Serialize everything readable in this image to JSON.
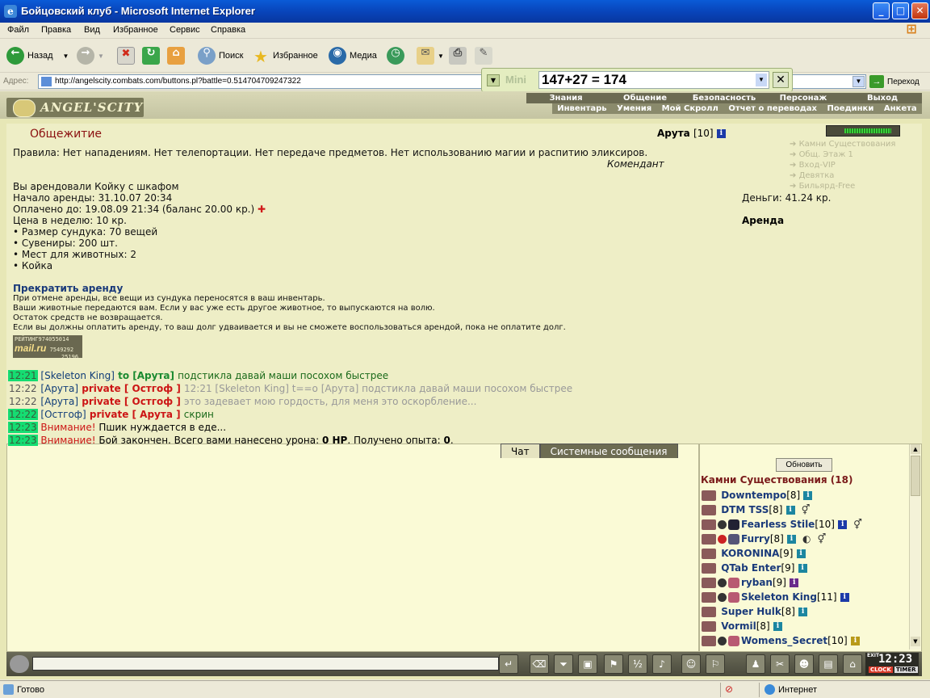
{
  "window": {
    "title": "Бойцовский клуб - Microsoft Internet Explorer",
    "logo_glyph": "e"
  },
  "menu": [
    "Файл",
    "Правка",
    "Вид",
    "Избранное",
    "Сервис",
    "Справка"
  ],
  "toolbar": {
    "back": "Назад",
    "search": "Поиск",
    "favorites": "Избранное",
    "media": "Медиа"
  },
  "address": {
    "label": "Адрес:",
    "url": "http://angelscity.combats.com/buttons.pl?battle=0.514704709247322",
    "go": "Переход"
  },
  "mini": {
    "label": "Mini",
    "value": "147+27 = 174"
  },
  "game": {
    "logo": "ANGEL'SCITY",
    "nav_top": [
      "Знания",
      "Общение",
      "Безопасность",
      "Персонаж",
      "Выход"
    ],
    "nav_sub": [
      "Инвентарь",
      "Умения",
      "Мой Скролл",
      "Отчет о переводах",
      "Поединки",
      "Анкета"
    ]
  },
  "room": {
    "title": "Общежитие",
    "rules": "Правила: Нет нападениям. Нет телепортации. Нет передаче предметов. Нет использованию магии и распитию эликсиров.",
    "signature": "Комендант",
    "rented": "Вы арендовали Койку с шкафом",
    "start": "Начало аренды: 31.10.07 20:34",
    "paid": "Оплачено до: 19.08.09 21:34 (баланс 20.00 кр.)",
    "price": "Цена в неделю: 10 кр.",
    "features": [
      "• Размер сундука: 70 вещей",
      "• Сувениры: 200 шт.",
      "• Мест для животных: 2",
      "• Койка"
    ],
    "cancel_link": "Прекратить аренду",
    "notes": [
      "При отмене аренды, все вещи из сундука переносятся в ваш инвентарь.",
      "Ваши животные передаются вам. Если у вас уже есть другое животное, то выпускаются на волю.",
      "Остаток средств не возвращается.",
      "Если вы должны оплатить аренду, то ваш долг удваивается и вы не сможете воспользоваться арендой, пока не оплатите долг."
    ],
    "counter": {
      "label": "РЕЙТИНГ",
      "brand": "mail.ru",
      "n1": "974055014",
      "n2": "7549292",
      "n3": "25196"
    }
  },
  "sidebar": {
    "player": "Арута",
    "player_level": "[10]",
    "links": [
      "Камни Существования",
      "Общ. Этаж 1",
      "Вход-VIP",
      "Девятка",
      "Бильярд-Free"
    ],
    "money": "Деньги: 41.24 кр.",
    "section": "Аренда"
  },
  "chat": {
    "tabs": [
      "Чат",
      "Системные сообщения"
    ],
    "lines": [
      {
        "time": "12:21",
        "a": "[Skeleton King]",
        "b": " to [Арута] ",
        "c": "подстикла давай маши посохом быстрее",
        "kind": "to"
      },
      {
        "time": "12:22",
        "a": "[Арута]",
        "b": " private [ Остгоф ] ",
        "c": "12:21 [Skeleton King] t==o [Арута] подстикла давай маши посохом быстрее",
        "kind": "priv"
      },
      {
        "time": "12:22",
        "a": "[Арута]",
        "b": " private [ Остгоф ] ",
        "c": "это задевает мою гордость, для меня это оскорбление...",
        "kind": "priv"
      },
      {
        "time": "12:22",
        "a": "[Остгоф]",
        "b": " private [ Арута ] ",
        "c": "скрин",
        "kind": "priv2"
      },
      {
        "time": "12:23",
        "a": "Внимание!",
        "b": " Пшик нуждается в еде...",
        "c": "",
        "kind": "warn"
      },
      {
        "time": "12:23",
        "a": "Внимание!",
        "b": " Бой закончен. Всего вами нанесено урона: ",
        "c": "0 HP",
        "d": ". Получено опыта: ",
        "e": "0",
        "f": ".",
        "kind": "warn2"
      }
    ]
  },
  "players": {
    "refresh": "Обновить",
    "title": "Камни Существования (18)",
    "list": [
      {
        "name": "Downtempo",
        "level": "[8]"
      },
      {
        "name": "DTM TSS",
        "level": "[8]"
      },
      {
        "name": "Fearless Stile",
        "level": "[10]"
      },
      {
        "name": "Furry",
        "level": "[8]"
      },
      {
        "name": "KORONINA",
        "level": "[9]"
      },
      {
        "name": "QTab Enter",
        "level": "[9]"
      },
      {
        "name": "ryban",
        "level": "[9]"
      },
      {
        "name": "Skeleton King",
        "level": "[11]"
      },
      {
        "name": "Super Hulk",
        "level": "[8]"
      },
      {
        "name": "Vormil",
        "level": "[8]"
      },
      {
        "name": "Womens_Secret",
        "level": "[10]"
      }
    ]
  },
  "clock": {
    "time": "12:23",
    "clock_label": "CLOCK",
    "timer_label": "TIMER",
    "exit_label": "EXIT"
  },
  "status": {
    "left": "Готово",
    "right": "Интернет"
  }
}
